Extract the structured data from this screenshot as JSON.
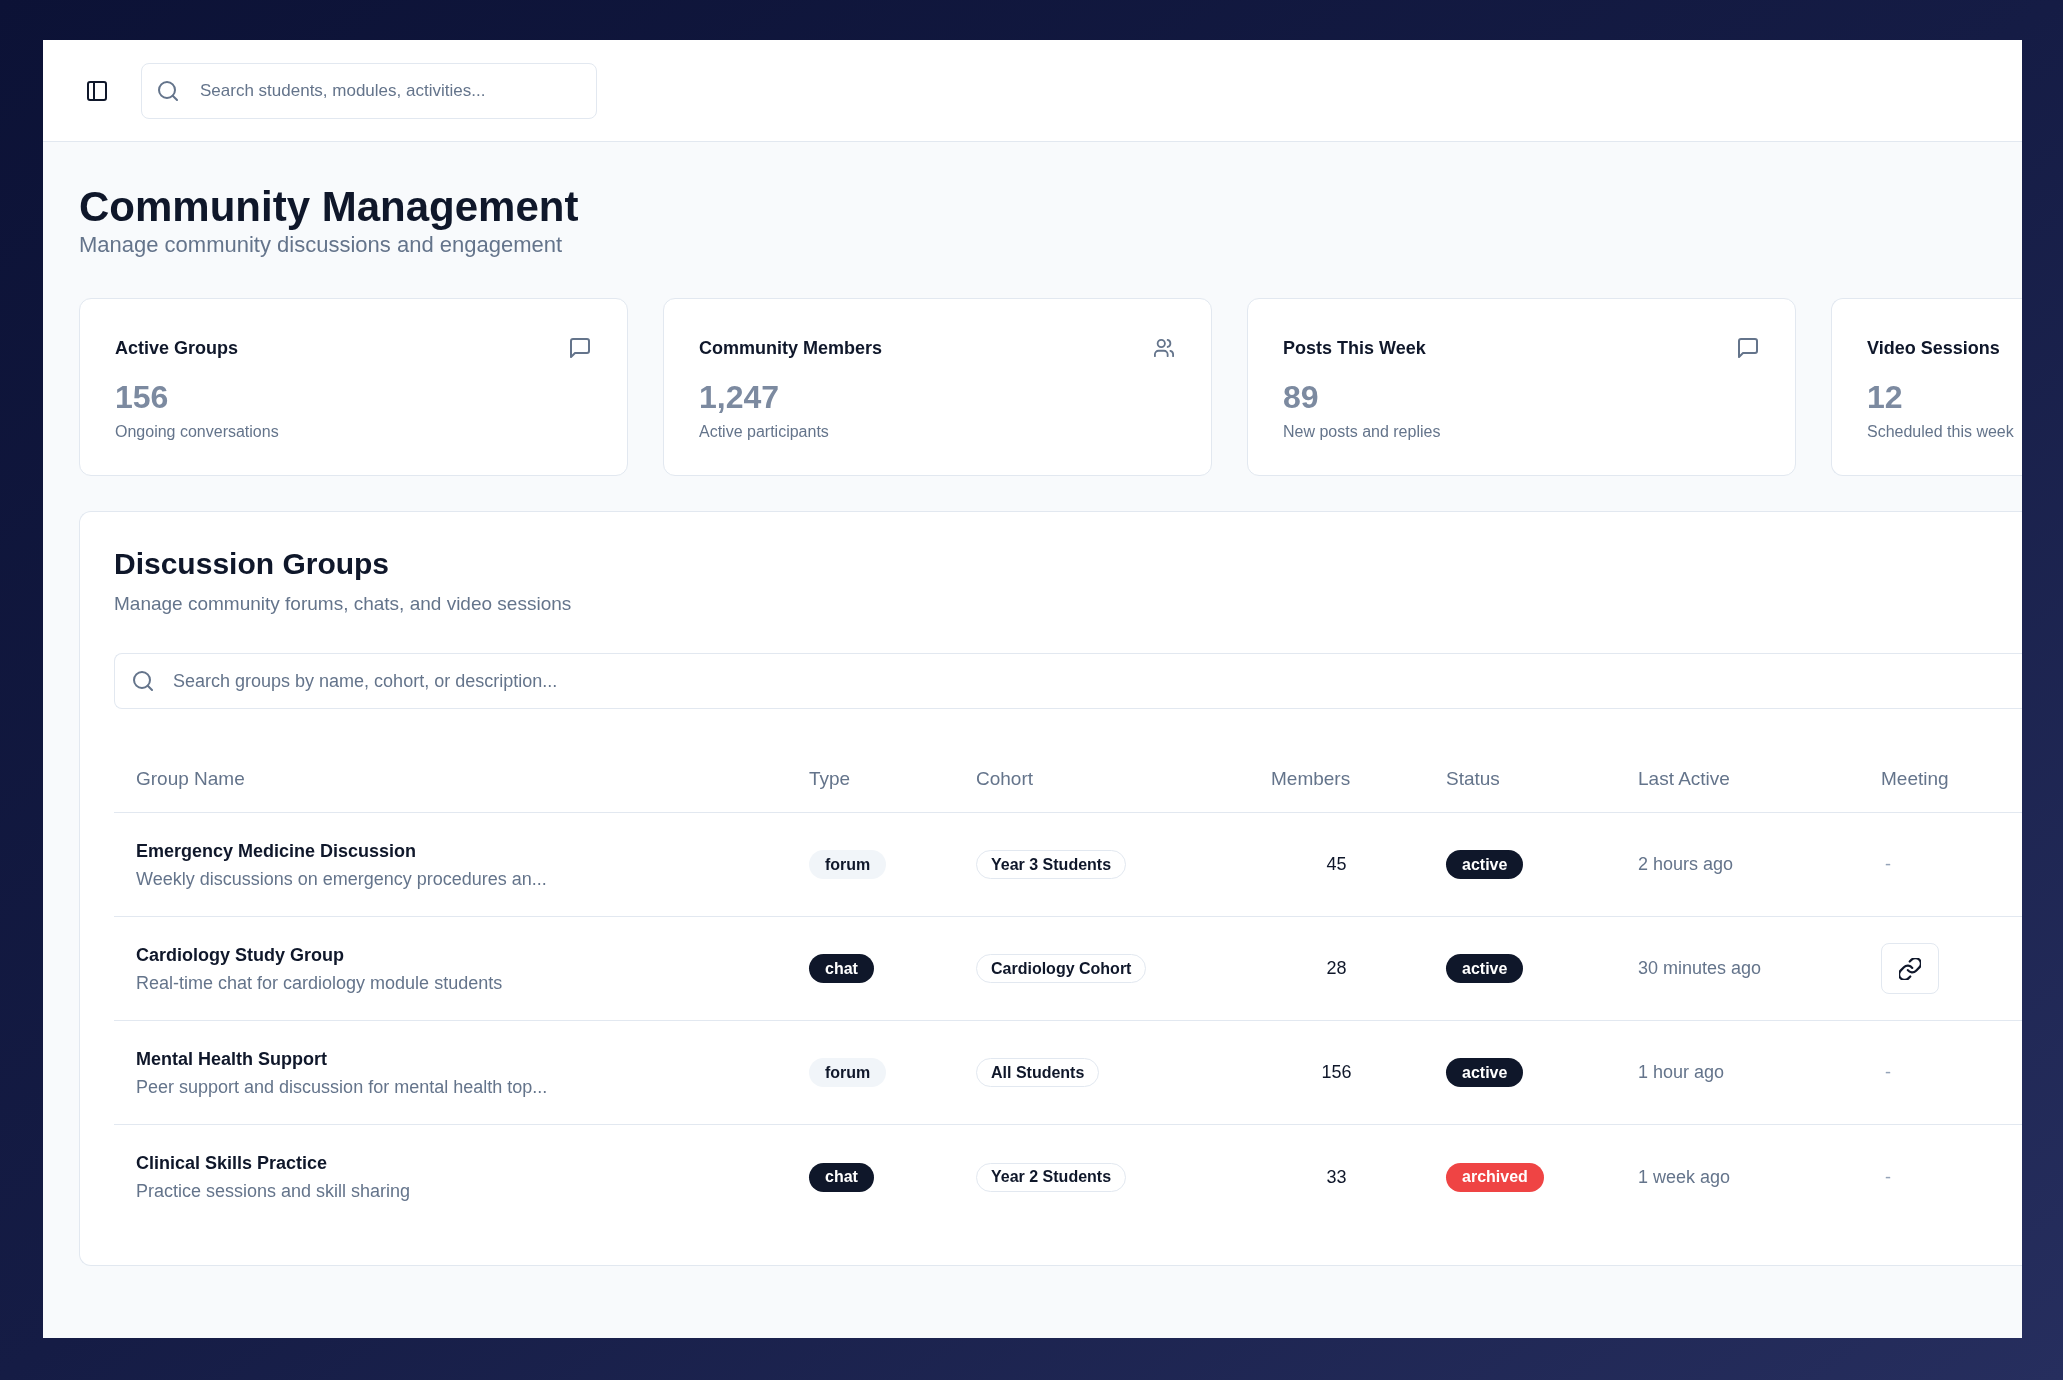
{
  "header": {
    "search": {
      "placeholder": "Search students, modules, activities..."
    }
  },
  "page": {
    "title": "Community Management",
    "subtitle": "Manage community discussions and engagement"
  },
  "stats": [
    {
      "title": "Active Groups",
      "value": "156",
      "caption": "Ongoing conversations"
    },
    {
      "title": "Community Members",
      "value": "1,247",
      "caption": "Active participants"
    },
    {
      "title": "Posts This Week",
      "value": "89",
      "caption": "New posts and replies"
    },
    {
      "title": "Video Sessions",
      "value": "12",
      "caption": "Scheduled this week"
    }
  ],
  "groups_panel": {
    "title": "Discussion Groups",
    "subtitle": "Manage community forums, chats, and video sessions",
    "search": {
      "placeholder": "Search groups by name, cohort, or description..."
    },
    "table": {
      "columns": [
        "Group Name",
        "Type",
        "Cohort",
        "Members",
        "Status",
        "Last Active",
        "Meeting"
      ],
      "rows": [
        {
          "name": "Emergency Medicine Discussion",
          "description": "Weekly discussions on emergency procedures an...",
          "type": {
            "label": "forum",
            "kind": "secondary"
          },
          "cohort": "Year 3 Students",
          "members": "45",
          "status": {
            "label": "active",
            "kind": "default"
          },
          "last_active": "2 hours ago",
          "meeting": {
            "kind": "text",
            "text": "-"
          }
        },
        {
          "name": "Cardiology Study Group",
          "description": "Real-time chat for cardiology module students",
          "type": {
            "label": "chat",
            "kind": "primary"
          },
          "cohort": "Cardiology Cohort",
          "members": "28",
          "status": {
            "label": "active",
            "kind": "default"
          },
          "last_active": "30 minutes ago",
          "meeting": {
            "kind": "link"
          }
        },
        {
          "name": "Mental Health Support",
          "description": "Peer support and discussion for mental health top...",
          "type": {
            "label": "forum",
            "kind": "secondary"
          },
          "cohort": "All Students",
          "members": "156",
          "status": {
            "label": "active",
            "kind": "default"
          },
          "last_active": "1 hour ago",
          "meeting": {
            "kind": "text",
            "text": "-"
          }
        },
        {
          "name": "Clinical Skills Practice",
          "description": "Practice sessions and skill sharing",
          "type": {
            "label": "chat",
            "kind": "primary"
          },
          "cohort": "Year 2 Students",
          "members": "33",
          "status": {
            "label": "archived",
            "kind": "destructive"
          },
          "last_active": "1 week ago",
          "meeting": {
            "kind": "text",
            "text": "-"
          }
        }
      ]
    }
  }
}
